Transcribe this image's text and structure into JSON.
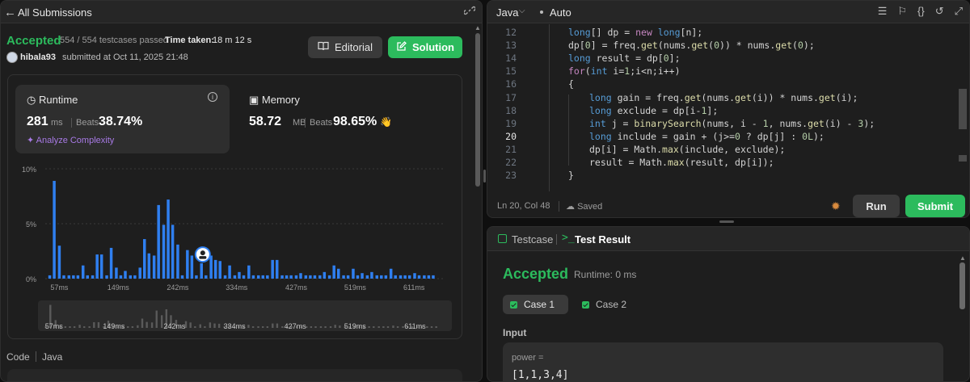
{
  "left": {
    "header_title": "All Submissions",
    "status": "Accepted",
    "testcases": "554 / 554 testcases passed",
    "time_taken_label": "Time taken:",
    "time_taken_value": "18 m 12 s",
    "username": "hibala93",
    "submitted_at": "submitted at Oct 11, 2025 21:48",
    "editorial_label": "Editorial",
    "solution_label": "Solution",
    "runtime": {
      "title": "Runtime",
      "value": "281",
      "unit": "ms",
      "beats_label": "Beats",
      "beats_pct": "38.74%",
      "analyze": "Analyze Complexity"
    },
    "memory": {
      "title": "Memory",
      "value": "58.72",
      "unit": "MB",
      "beats_label": "Beats",
      "beats_pct": "98.65%",
      "emoji": "👋"
    },
    "code_label": "Code",
    "code_lang": "Java"
  },
  "chart_data": {
    "type": "bar",
    "title": "",
    "xlabel": "",
    "ylabel": "",
    "ylim": [
      0,
      10
    ],
    "ytick_labels": [
      "10%",
      "5%",
      "0%"
    ],
    "xtick_labels": [
      "57ms",
      "149ms",
      "242ms",
      "334ms",
      "427ms",
      "519ms",
      "611ms"
    ],
    "x_range_ms": [
      35,
      660
    ],
    "bar_width_ms": 8,
    "user_marker_ms": 281,
    "bar_color": "#2f7ff0",
    "x_ms": [
      42,
      49,
      57,
      64,
      72,
      79,
      86,
      94,
      101,
      109,
      116,
      123,
      131,
      138,
      146,
      153,
      160,
      168,
      175,
      183,
      190,
      197,
      205,
      212,
      220,
      227,
      234,
      242,
      249,
      257,
      264,
      271,
      279,
      286,
      294,
      301,
      308,
      316,
      323,
      331,
      338,
      345,
      353,
      360,
      368,
      375,
      382,
      390,
      397,
      405,
      412,
      419,
      427,
      434,
      442,
      449,
      456,
      464,
      471,
      479,
      486,
      493,
      501,
      508,
      516,
      523,
      530,
      538,
      545,
      553,
      560,
      567,
      575,
      582,
      590,
      597,
      604,
      612,
      619,
      627,
      634,
      641
    ],
    "values": [
      0.3,
      8.9,
      3.0,
      0.3,
      0.3,
      0.3,
      0.3,
      1.2,
      0.3,
      0.3,
      2.2,
      2.2,
      0.3,
      2.8,
      1.0,
      0.3,
      0.7,
      0.3,
      0.3,
      1.0,
      3.6,
      2.3,
      2.1,
      6.7,
      4.9,
      7.2,
      4.9,
      3.1,
      0.3,
      2.6,
      2.1,
      0.3,
      1.4,
      0.3,
      2.1,
      1.7,
      1.6,
      0.3,
      1.2,
      0.3,
      0.6,
      0.3,
      1.2,
      0.3,
      0.3,
      0.3,
      0.3,
      1.7,
      1.7,
      0.3,
      0.3,
      0.3,
      0.3,
      0.5,
      0.3,
      0.3,
      0.3,
      0.3,
      0.6,
      0.3,
      1.2,
      0.9,
      0.3,
      0.3,
      0.9,
      0.3,
      0.5,
      0.3,
      0.6,
      0.3,
      0.3,
      0.3,
      0.9,
      0.3,
      0.3,
      0.3,
      0.3,
      0.5,
      0.3,
      0.3,
      0.3,
      0.3
    ]
  },
  "editor": {
    "language": "Java",
    "mode": "Auto",
    "lines": [
      {
        "n": "12",
        "code": "long[] dp = new long[n];"
      },
      {
        "n": "13",
        "code": "dp[0] = freq.get(nums.get(0)) * nums.get(0);"
      },
      {
        "n": "14",
        "code": "long result = dp[0];"
      },
      {
        "n": "15",
        "code": "for(int i=1;i<n;i++)"
      },
      {
        "n": "16",
        "code": "{"
      },
      {
        "n": "17",
        "code": "long gain = freq.get(nums.get(i)) * nums.get(i);"
      },
      {
        "n": "18",
        "code": "long exclude = dp[i-1];"
      },
      {
        "n": "19",
        "code": "int j = binarySearch(nums, i - 1, nums.get(i) - 3);"
      },
      {
        "n": "20",
        "code": "long include = gain + (j>=0 ? dp[j] : 0L);"
      },
      {
        "n": "21",
        "code": "dp[i] = Math.max(include, exclude);"
      },
      {
        "n": "22",
        "code": "result = Math.max(result, dp[i]);"
      },
      {
        "n": "23",
        "code": "}"
      }
    ],
    "cursor_position": "Ln 20, Col 48",
    "saved_label": "Saved",
    "run_label": "Run",
    "submit_label": "Submit"
  },
  "testpanel": {
    "testcase_tab": "Testcase",
    "result_tab": "Test Result",
    "status": "Accepted",
    "runtime": "Runtime: 0 ms",
    "case1": "Case 1",
    "case2": "Case 2",
    "input_label": "Input",
    "var_name": "power =",
    "var_value": "[1,1,3,4]"
  }
}
